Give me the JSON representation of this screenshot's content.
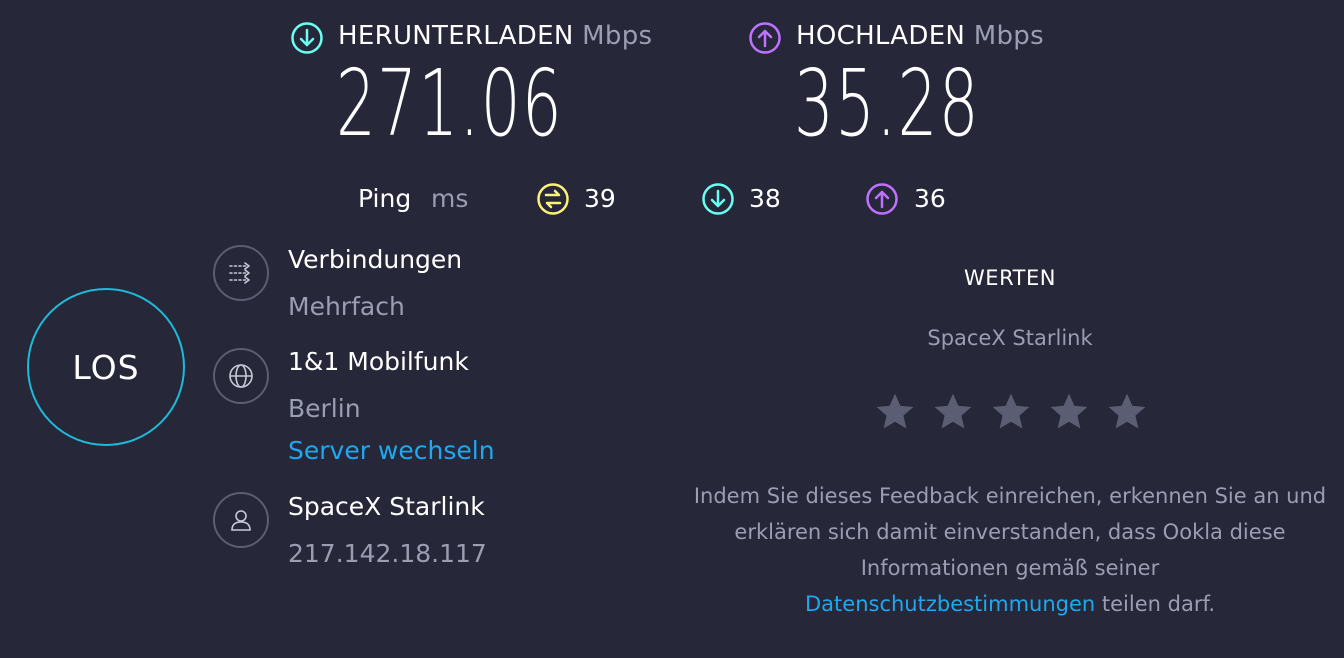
{
  "download": {
    "label": "HERUNTERLADEN",
    "unit": "Mbps",
    "value": "271.06"
  },
  "upload": {
    "label": "HOCHLADEN",
    "unit": "Mbps",
    "value": "35.28"
  },
  "ping": {
    "label": "Ping",
    "unit": "ms",
    "idle": "39",
    "download": "38",
    "upload": "36"
  },
  "go_button": {
    "label": "LOS"
  },
  "connections": {
    "title": "Verbindungen",
    "value": "Mehrfach"
  },
  "server": {
    "title": "1&1 Mobilfunk",
    "location": "Berlin",
    "change_link": "Server wechseln"
  },
  "provider": {
    "title": "SpaceX Starlink",
    "ip": "217.142.18.117"
  },
  "rating": {
    "title": "WERTEN",
    "isp": "SpaceX Starlink",
    "star_count": 5,
    "feedback_text": "Indem Sie dieses Feedback einreichen, erkennen Sie an und erklären sich damit einverstanden, dass Ookla diese Informationen gemäß seiner",
    "privacy_link": "Datenschutzbestimmungen",
    "feedback_suffix": " teilen darf."
  },
  "colors": {
    "background": "#262739",
    "download_accent": "#6afff3",
    "upload_accent": "#bf71ff",
    "ping_accent": "#fbf277",
    "go_ring": "#1fbad9",
    "link": "#1ea8f0",
    "muted_text": "#9b9db3"
  }
}
